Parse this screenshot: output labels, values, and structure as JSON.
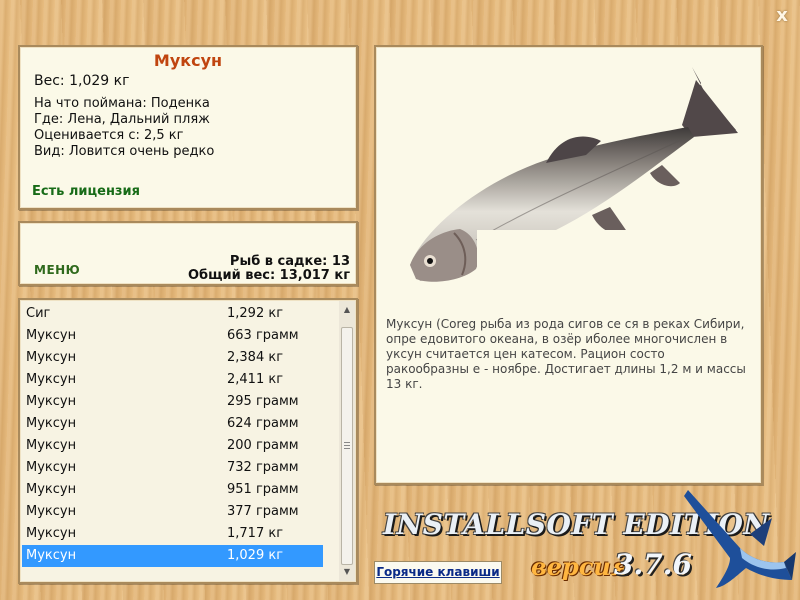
{
  "close_label": "x",
  "info": {
    "fish_name": "Муксун",
    "weight": "Вес: 1,029 кг",
    "caught_with": "На что поймана: Поденка",
    "location": "Где: Лена, Дальний пляж",
    "valued_from": "Оценивается с: 2,5 кг",
    "kind": "Вид: Ловится очень редко",
    "license": "Есть лицензия"
  },
  "summary": {
    "menu_label": "МЕНЮ",
    "fish_count": "Рыб в садке: 13",
    "total_weight": "Общий вес: 13,017 кг"
  },
  "catch_list": [
    {
      "name": "Сиг",
      "weight": "1,292 кг"
    },
    {
      "name": "Муксун",
      "weight": "663 грамм"
    },
    {
      "name": "Муксун",
      "weight": "2,384 кг"
    },
    {
      "name": "Муксун",
      "weight": "2,411 кг"
    },
    {
      "name": "Муксун",
      "weight": "295 грамм"
    },
    {
      "name": "Муксун",
      "weight": "624 грамм"
    },
    {
      "name": "Муксун",
      "weight": "200 грамм"
    },
    {
      "name": "Муксун",
      "weight": "732 грамм"
    },
    {
      "name": "Муксун",
      "weight": "951 грамм"
    },
    {
      "name": "Муксун",
      "weight": "377 грамм"
    },
    {
      "name": "Муксун",
      "weight": "1,717 кг"
    },
    {
      "name": "Муксун",
      "weight": "1,029 кг"
    }
  ],
  "selected_row": 11,
  "description": "Муксун (Coreg                                       рыба из рода сигов се                                       ся в реках Сибири, опре                                        едовитого океана, в озёр                                        иболее многочислен в                                           уксун считается цен                                           катесом. Рацион состо                                            ракообразны                                             е - ноябре. Достигает длины 1,2 м и массы 13 кг.",
  "hotkeys_label": "Горячие клавиши",
  "edition_title": "INSTALLSOFT EDITION",
  "version_label": "версия",
  "version_number": "3.7.6",
  "colors": {
    "fish_name": "#c0450f",
    "license": "#176b17",
    "selection": "#3399ff",
    "hotkeys": "#0a2a88"
  }
}
